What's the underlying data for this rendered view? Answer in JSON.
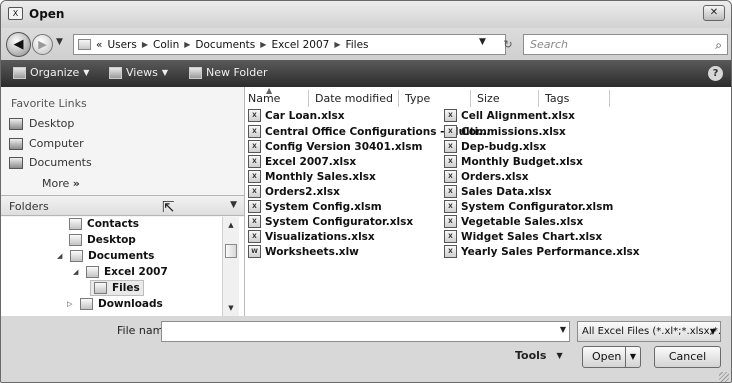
{
  "window": {
    "title": "Open",
    "close_label": "✕"
  },
  "address": {
    "back_icon": "back-arrow-icon",
    "crumbs": [
      "«",
      "Users",
      "Colin",
      "Documents",
      "Excel 2007",
      "Files"
    ],
    "search_placeholder": "Search"
  },
  "toolbar": {
    "organize_label": "Organize",
    "views_label": "Views",
    "new_folder_label": "New Folder",
    "help_label": "?"
  },
  "nav": {
    "favorites_heading": "Favorite Links",
    "favorites": [
      "Desktop",
      "Computer",
      "Documents"
    ],
    "more_label": "More",
    "more_arrow": "»",
    "folders_label": "Folders",
    "tree": [
      {
        "label": "Contacts",
        "toggle": ""
      },
      {
        "label": "Desktop",
        "toggle": ""
      },
      {
        "label": "Documents",
        "toggle": "◢"
      },
      {
        "label": "Excel 2007",
        "toggle": "◢"
      },
      {
        "label": "Files",
        "toggle": ""
      },
      {
        "label": "Downloads",
        "toggle": "▷"
      }
    ]
  },
  "files": {
    "columns": [
      "Name",
      "Date modified",
      "Type",
      "Size",
      "Tags"
    ],
    "col1": [
      "Car Loan.xlsx",
      "Central Office Configurations - Multi...",
      "Config Version 30401.xlsm",
      "Excel 2007.xlsx",
      "Monthly Sales.xlsx",
      "Orders2.xlsx",
      "System Config.xlsm",
      "System Configurator.xlsx",
      "Visualizations.xlsx",
      "Worksheets.xlw"
    ],
    "col2": [
      "Cell Alignment.xlsx",
      "Commissions.xlsx",
      "Dep-budg.xlsx",
      "Monthly Budget.xlsx",
      "Orders.xlsx",
      "Sales Data.xlsx",
      "System Configurator.xlsm",
      "Vegetable Sales.xlsx",
      "Widget Sales Chart.xlsx",
      "Yearly Sales Performance.xlsx"
    ]
  },
  "footer": {
    "file_name_label": "File name:",
    "file_name_value": "",
    "filter_value": "All Excel Files (*.xl*;*.xlsx;*.xlsr",
    "tools_label": "Tools",
    "open_label": "Open",
    "cancel_label": "Cancel"
  }
}
